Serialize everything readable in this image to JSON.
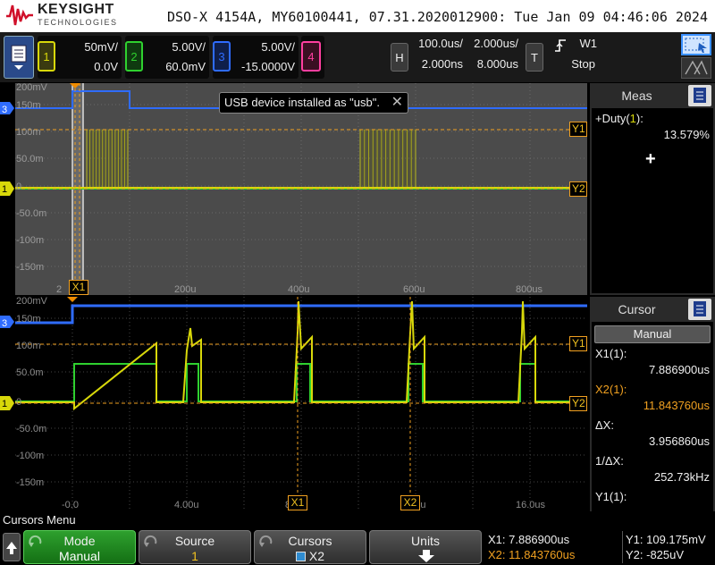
{
  "header": {
    "brand": "KEYSIGHT",
    "brand_sub": "TECHNOLOGIES",
    "info": "DSO-X 4154A, MY60100441, 07.31.2020012900: Tue Jan 09 04:46:06 2024"
  },
  "channels": [
    {
      "num": "1",
      "scale": "50mV/",
      "offset": "0.0V",
      "color": "#d8d80a"
    },
    {
      "num": "2",
      "scale": "5.00V/",
      "offset": "60.0mV",
      "color": "#2fd12f"
    },
    {
      "num": "3",
      "scale": "5.00V/",
      "offset": "-15.0000V",
      "color": "#2f6cff"
    },
    {
      "num": "4",
      "scale": "",
      "offset": "",
      "color": "#ff3fa0"
    }
  ],
  "timebase": {
    "h_label": "H",
    "h_scale": "100.0us/",
    "h_delay": "2.000ns",
    "zoom_scale": "2.000us/",
    "zoom_delay": "8.000us",
    "t_label": "T",
    "trigger_source": "W1",
    "run_state": "Stop"
  },
  "notification": "USB device installed as \"usb\".",
  "upper_pane": {
    "y_labels": [
      "200mV",
      "150m",
      "100m",
      "50.0m",
      "0",
      "-50.0m",
      "-100m",
      "-150m"
    ],
    "x_labels": [
      "200u",
      "400u",
      "600u",
      "800us"
    ],
    "x_label_first": "2"
  },
  "lower_pane": {
    "y_labels": [
      "200mV",
      "150m",
      "100m",
      "50.0m",
      "0",
      "-50.0m",
      "-100m",
      "-150m"
    ],
    "x_labels": [
      "-0.0",
      "4.00u",
      "8",
      "12.0u",
      "16.0us"
    ]
  },
  "markers": {
    "x1": "X1",
    "x2": "X2",
    "y1": "Y1",
    "y2": "Y2",
    "ch1": "1",
    "ch3": "3"
  },
  "meas_panel": {
    "title": "Meas",
    "item_prefix": "+Duty(",
    "item_ch": "1",
    "item_suffix": "):",
    "item_value": "13.579%",
    "add_symbol": "+"
  },
  "cursor_panel": {
    "title": "Cursor",
    "mode": "Manual",
    "x1_label": "X1(1):",
    "x1_value": "7.886900us",
    "x2_label": "X2(1):",
    "x2_value": "11.843760us",
    "dx_label": "ΔX:",
    "dx_value": "3.956860us",
    "inv_dx_label": "1/ΔX:",
    "inv_dx_value": "252.73kHz",
    "y1_label": "Y1(1):"
  },
  "menu_title": "Cursors Menu",
  "softkeys": {
    "mode_label": "Mode",
    "mode_value": "Manual",
    "source_label": "Source",
    "source_value": "1",
    "cursors_label": "Cursors",
    "cursors_value": "X2",
    "units_label": "Units"
  },
  "readouts": {
    "x1": "X1: 7.886900us",
    "x2": "X2: 11.843760us",
    "y1": "Y1: 109.175mV",
    "y2": "Y2: -825uV"
  },
  "colors": {
    "ch1": "#d8d80a",
    "ch2": "#2fd12f",
    "ch3": "#2f6cff",
    "cursor": "#f0a020",
    "accent_orange": "#f08c00"
  }
}
